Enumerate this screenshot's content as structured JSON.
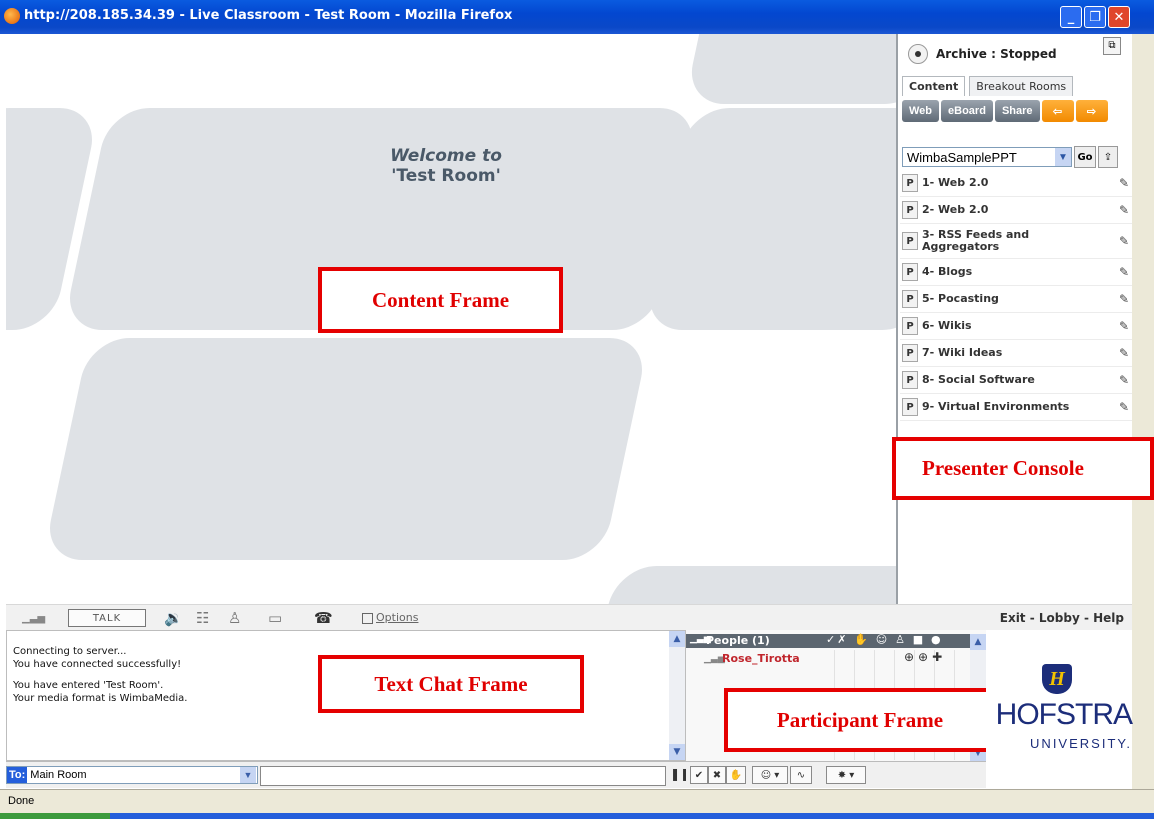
{
  "window": {
    "title": "http://208.185.34.39 - Live Classroom - Test Room - Mozilla Firefox",
    "controls": {
      "minimize": "_",
      "maximize": "❐",
      "close": "✕"
    }
  },
  "content": {
    "welcome_line1": "Welcome to",
    "welcome_line2": "'Test Room'"
  },
  "annotations": {
    "content_frame": "Content Frame",
    "presenter_console": "Presenter Console",
    "text_chat_frame": "Text Chat Frame",
    "participant_frame": "Participant Frame"
  },
  "console": {
    "archive_status": "Archive : Stopped",
    "tabs": [
      {
        "label": "Content",
        "active": true
      },
      {
        "label": "Breakout Rooms",
        "active": false
      }
    ],
    "toolbar": {
      "web": "Web",
      "eboard": "eBoard",
      "share": "Share"
    },
    "deck": {
      "selected": "WimbaSamplePPT",
      "go": "Go"
    },
    "slides": [
      {
        "badge": "P",
        "title": "1- Web 2.0"
      },
      {
        "badge": "P",
        "title": "2- Web 2.0"
      },
      {
        "badge": "P",
        "title": "3- RSS Feeds and Aggregators"
      },
      {
        "badge": "P",
        "title": "4- Blogs"
      },
      {
        "badge": "P",
        "title": "5- Pocasting"
      },
      {
        "badge": "P",
        "title": "6- Wikis"
      },
      {
        "badge": "P",
        "title": "7- Wiki Ideas"
      },
      {
        "badge": "P",
        "title": "8- Social Software"
      },
      {
        "badge": "P",
        "title": "9- Virtual Environments"
      }
    ]
  },
  "audiobar": {
    "talk": "TALK",
    "options": "Options",
    "links": "Exit - Lobby - Help"
  },
  "chat": {
    "messages": [
      "Connecting to server...",
      "You have connected successfully!",
      "",
      "You have entered 'Test Room'.",
      "Your media format is WimbaMedia."
    ],
    "to_label": "To:",
    "to_value": "Main Room"
  },
  "people": {
    "header": "People (1)",
    "participants": [
      {
        "name": "Rose_Tirotta"
      }
    ]
  },
  "logo": {
    "shield_letter": "H",
    "name": "HOFSTRA",
    "sub": "UNIVERSITY."
  },
  "status": {
    "text": "Done"
  }
}
